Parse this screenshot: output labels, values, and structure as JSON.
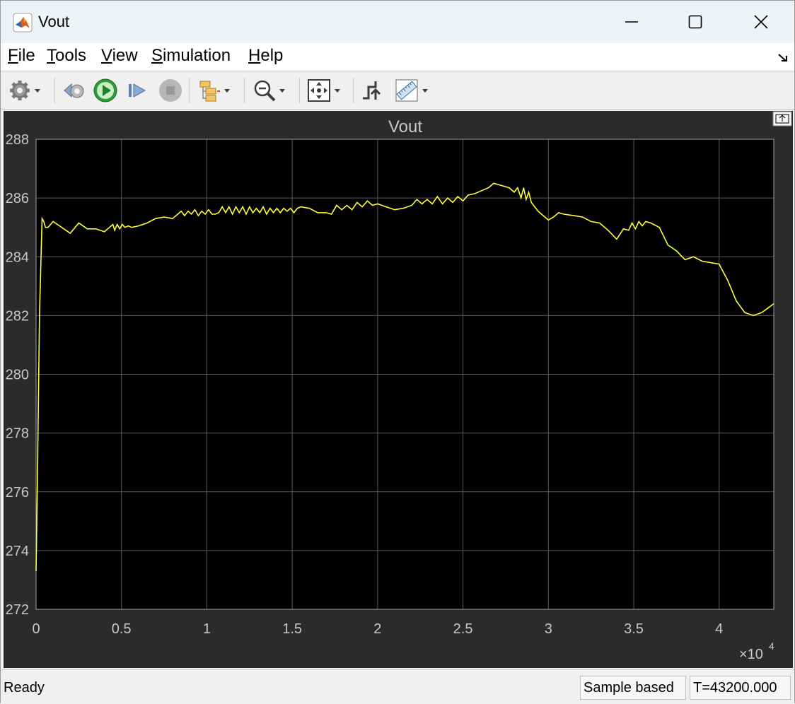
{
  "window": {
    "title": "Vout"
  },
  "menu": {
    "file": {
      "u": "F",
      "rest": "ile"
    },
    "tools": {
      "u": "T",
      "rest": "ools"
    },
    "view": {
      "u": "V",
      "rest": "iew"
    },
    "simulation": {
      "u": "S",
      "rest": "imulation"
    },
    "help": {
      "u": "H",
      "rest": "elp"
    }
  },
  "toolbar_icons": [
    "gear-icon",
    "step-back-icon",
    "run-icon",
    "step-forward-icon",
    "stop-icon",
    "signal-hierarchy-icon",
    "zoom-icon",
    "fit-to-view-icon",
    "triggers-icon",
    "measurements-icon"
  ],
  "colors": {
    "trace": "#ffff36",
    "plot_bg": "#000000",
    "panel_bg": "#2b2b2b",
    "axis_text": "#c8c8c8",
    "grid": "#5a5a5a"
  },
  "chart_data": {
    "type": "line",
    "title": "Vout",
    "xlabel": "",
    "ylabel": "",
    "x_exponent": "×10",
    "x_exponent_power": "4",
    "xlim": [
      0,
      43200
    ],
    "ylim": [
      272,
      288
    ],
    "grid": true,
    "x_ticks": [
      0,
      5000,
      10000,
      15000,
      20000,
      25000,
      30000,
      35000,
      40000
    ],
    "x_tick_labels": [
      "0",
      "0.5",
      "1",
      "1.5",
      "2",
      "2.5",
      "3",
      "3.5",
      "4"
    ],
    "y_ticks": [
      272,
      274,
      276,
      278,
      280,
      282,
      284,
      286,
      288
    ],
    "y_tick_labels": [
      "272",
      "274",
      "276",
      "278",
      "280",
      "282",
      "284",
      "286",
      "288"
    ],
    "series": [
      {
        "color": "#ffff36",
        "x": [
          0,
          80,
          200,
          350,
          450,
          550,
          700,
          1000,
          1500,
          2000,
          2500,
          3000,
          3500,
          4000,
          4500,
          4600,
          4750,
          4900,
          5050,
          5200,
          5400,
          5600,
          6000,
          6500,
          7000,
          7500,
          8000,
          8500,
          8700,
          8900,
          9100,
          9300,
          9500,
          9700,
          9900,
          10100,
          10300,
          10500,
          10700,
          10900,
          11100,
          11300,
          11500,
          11700,
          11900,
          12100,
          12300,
          12500,
          12700,
          12900,
          13100,
          13300,
          13500,
          13700,
          13900,
          14100,
          14300,
          14500,
          14700,
          14900,
          15100,
          15300,
          15500,
          16000,
          16500,
          17000,
          17300,
          17600,
          17900,
          18200,
          18500,
          18800,
          19100,
          19400,
          19700,
          20000,
          20500,
          21000,
          21500,
          22000,
          22300,
          22600,
          22900,
          23200,
          23500,
          23800,
          24100,
          24400,
          24700,
          25000,
          25300,
          25700,
          26100,
          26500,
          26800,
          27100,
          27400,
          27700,
          28000,
          28200,
          28400,
          28550,
          28700,
          28850,
          29000,
          29200,
          29400,
          29600,
          29800,
          30000,
          30300,
          30600,
          30900,
          31500,
          32000,
          32500,
          33000,
          33500,
          34000,
          34400,
          34700,
          34900,
          35100,
          35300,
          35500,
          35700,
          36000,
          36500,
          37000,
          37500,
          38000,
          38500,
          39000,
          39500,
          40000,
          40500,
          41000,
          41500,
          42000,
          42500,
          43200
        ],
        "y": [
          273.3,
          276.4,
          282,
          285.3,
          285.2,
          285,
          285,
          285.2,
          285.0,
          284.8,
          285.15,
          284.95,
          284.95,
          284.85,
          285.1,
          284.9,
          285.1,
          284.95,
          285.1,
          285.0,
          285.05,
          285.0,
          285.05,
          285.15,
          285.3,
          285.35,
          285.3,
          285.55,
          285.4,
          285.55,
          285.45,
          285.6,
          285.4,
          285.55,
          285.45,
          285.6,
          285.45,
          285.45,
          285.5,
          285.7,
          285.5,
          285.7,
          285.45,
          285.7,
          285.5,
          285.7,
          285.45,
          285.7,
          285.5,
          285.65,
          285.5,
          285.7,
          285.45,
          285.65,
          285.5,
          285.65,
          285.5,
          285.65,
          285.55,
          285.65,
          285.5,
          285.65,
          285.7,
          285.65,
          285.5,
          285.5,
          285.45,
          285.75,
          285.6,
          285.75,
          285.6,
          285.85,
          285.7,
          285.9,
          285.75,
          285.8,
          285.7,
          285.6,
          285.65,
          285.75,
          285.95,
          285.8,
          285.95,
          285.8,
          286.05,
          285.8,
          286.0,
          285.85,
          286.05,
          285.9,
          286.1,
          286.15,
          286.25,
          286.35,
          286.5,
          286.45,
          286.4,
          286.35,
          286.2,
          286.35,
          286.0,
          286.35,
          285.95,
          286.2,
          285.85,
          285.7,
          285.55,
          285.45,
          285.35,
          285.25,
          285.35,
          285.5,
          285.45,
          285.4,
          285.35,
          285.2,
          285.15,
          284.9,
          284.6,
          284.95,
          284.9,
          285.15,
          284.95,
          285.2,
          285.05,
          285.2,
          285.15,
          285.0,
          284.4,
          284.2,
          283.9,
          284.0,
          283.85,
          283.8,
          283.75,
          283.2,
          282.5,
          282.1,
          282.0,
          282.1,
          282.4
        ]
      }
    ]
  },
  "status": {
    "ready": "Ready",
    "sample_mode": "Sample based",
    "time": "T=43200.000"
  }
}
